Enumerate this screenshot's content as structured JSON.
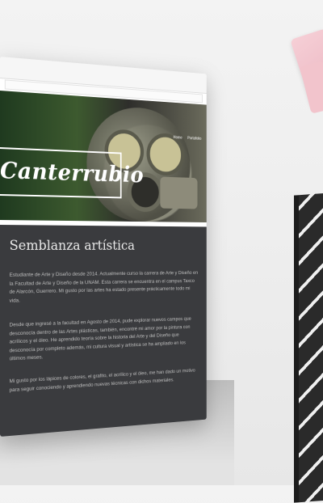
{
  "site": {
    "title": "Canterrubio",
    "nav": [
      "Home",
      "Portafolio"
    ]
  },
  "section": {
    "title": "Semblanza artística",
    "paragraphs": [
      "Estudiante de Arte y Diseño desde 2014. Actualmente curso la carrera de Arte y Diseño en la Facultad de Arte y Diseño de la UNAM. Esta carrera se encuentra en el campus Taxco de Alarcón, Guerrero. Mi gusto por las artes ha estado presente prácticamente todo mi vida.",
      "Desde que ingresé a la facultad en Agosto de 2014, pude explorar nuevos campos que desconocía dentro de las Artes plásticas, también, encontré mi amor por la pintura con acrílicos y el óleo. He aprendido teoría sobre la historia del Arte y del Diseño que desconocía por completo además, mi cultura visual y artística se ha ampliado en los últimos meses.",
      "Mi gusto por los lápices de colores, el grafito, el acrílico y el óleo, me han dado un motivo para seguir conociendo y aprendiendo nuevas técnicas con dichos materiales."
    ]
  },
  "colors": {
    "content_bg": "#3a3b3e",
    "text": "#bfbfbf",
    "accent_pink": "#f2c4cc"
  }
}
